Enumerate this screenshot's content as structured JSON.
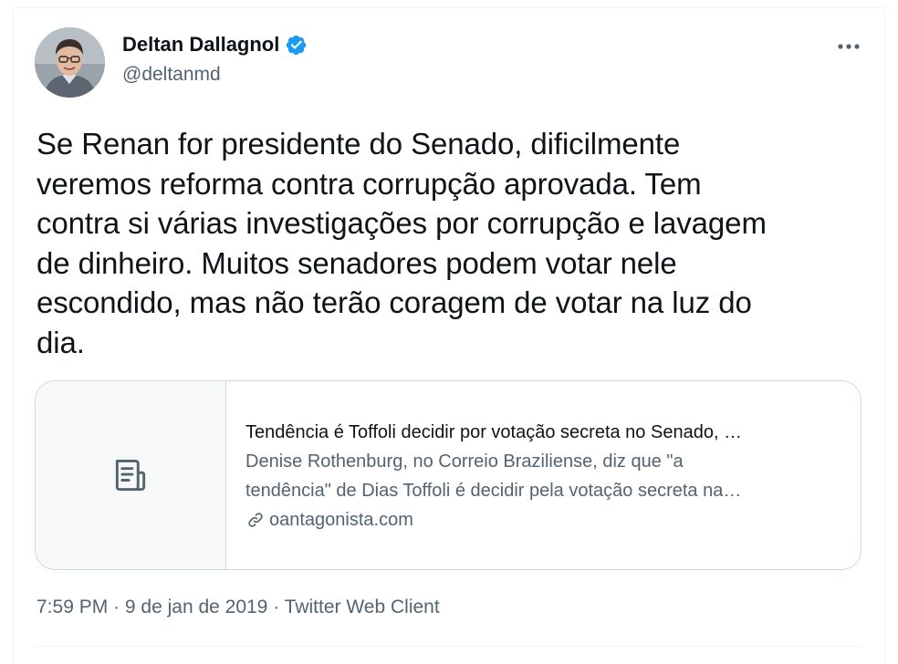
{
  "author": {
    "name": "Deltan Dallagnol",
    "handle": "@deltanmd",
    "verified": true,
    "verified_color": "#1d9bf0"
  },
  "more_icon": "more-horizontal-icon",
  "tweet": {
    "text": "Se Renan for presidente do Senado, dificilmente\nveremos reforma contra corrupção aprovada. Tem\ncontra si várias investigações por corrupção e lavagem\nde dinheiro. Muitos senadores podem votar nele\nescondido, mas não terão coragem de votar na luz do\ndia."
  },
  "card": {
    "icon": "article-icon",
    "title": "Tendência é Toffoli decidir por votação secreta no Senado, …",
    "description": "Denise Rothenburg, no Correio Braziliense, diz que \"a\ntendência\" de Dias Toffoli é decidir pela votação secreta na…",
    "domain_icon": "link-icon",
    "domain": "oantagonista.com"
  },
  "meta": {
    "time": "7:59 PM",
    "separator": " · ",
    "date": "9 de jan de 2019",
    "client": "Twitter Web Client"
  }
}
